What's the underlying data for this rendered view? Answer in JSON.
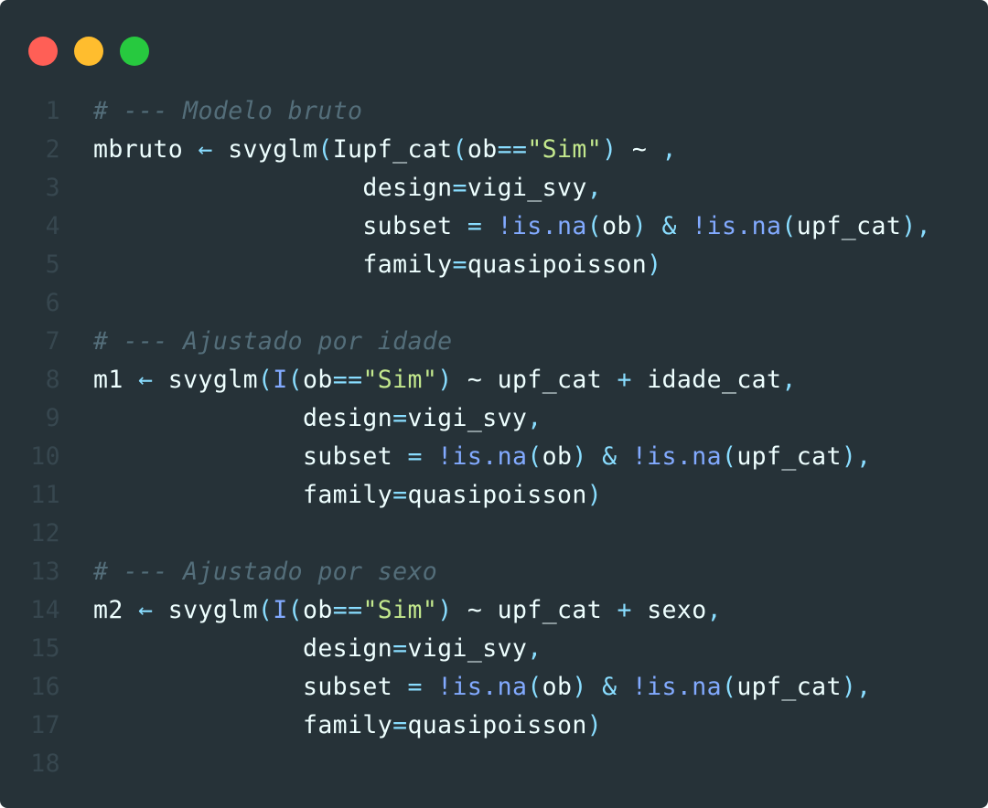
{
  "colors": {
    "background": "#263238",
    "text": "#eeffff",
    "comment": "#546e7a",
    "operator": "#89ddff",
    "string": "#c3e88d",
    "function": "#82aaff",
    "line_number": "#37474f"
  },
  "window_controls": [
    "close-dot",
    "minimize-dot",
    "maximize-dot"
  ],
  "lines": [
    [
      {
        "t": "# --- Modelo bruto",
        "c": "comment"
      }
    ],
    [
      {
        "t": "mbruto "
      },
      {
        "t": "←",
        "c": "op"
      },
      {
        "t": " svyglm"
      },
      {
        "t": "(",
        "c": "op"
      },
      {
        "t": "Iupf_cat"
      },
      {
        "t": "(",
        "c": "op"
      },
      {
        "t": "ob"
      },
      {
        "t": "==",
        "c": "op"
      },
      {
        "t": "\"Sim\"",
        "c": "str"
      },
      {
        "t": ")",
        "c": "op"
      },
      {
        "t": " ~ "
      },
      {
        "t": ",",
        "c": "op"
      }
    ],
    [
      {
        "t": "                  design"
      },
      {
        "t": "=",
        "c": "op"
      },
      {
        "t": "vigi_svy"
      },
      {
        "t": ",",
        "c": "op"
      }
    ],
    [
      {
        "t": "                  subset "
      },
      {
        "t": "=",
        "c": "op"
      },
      {
        "t": " "
      },
      {
        "t": "!is.na",
        "c": "fn"
      },
      {
        "t": "(",
        "c": "op"
      },
      {
        "t": "ob"
      },
      {
        "t": ")",
        "c": "op"
      },
      {
        "t": " "
      },
      {
        "t": "&",
        "c": "op"
      },
      {
        "t": " "
      },
      {
        "t": "!is.na",
        "c": "fn"
      },
      {
        "t": "(",
        "c": "op"
      },
      {
        "t": "upf_cat"
      },
      {
        "t": "),",
        "c": "op"
      }
    ],
    [
      {
        "t": "                  family"
      },
      {
        "t": "=",
        "c": "op"
      },
      {
        "t": "quasipoisson"
      },
      {
        "t": ")",
        "c": "op"
      }
    ],
    [],
    [
      {
        "t": "# --- Ajustado por idade",
        "c": "comment"
      }
    ],
    [
      {
        "t": "m1 "
      },
      {
        "t": "←",
        "c": "op"
      },
      {
        "t": " svyglm"
      },
      {
        "t": "(",
        "c": "op"
      },
      {
        "t": "I",
        "c": "fn"
      },
      {
        "t": "(",
        "c": "op"
      },
      {
        "t": "ob"
      },
      {
        "t": "==",
        "c": "op"
      },
      {
        "t": "\"Sim\"",
        "c": "str"
      },
      {
        "t": ")",
        "c": "op"
      },
      {
        "t": " ~ upf_cat "
      },
      {
        "t": "+",
        "c": "op"
      },
      {
        "t": " idade_cat"
      },
      {
        "t": ",",
        "c": "op"
      }
    ],
    [
      {
        "t": "              design"
      },
      {
        "t": "=",
        "c": "op"
      },
      {
        "t": "vigi_svy"
      },
      {
        "t": ",",
        "c": "op"
      }
    ],
    [
      {
        "t": "              subset "
      },
      {
        "t": "=",
        "c": "op"
      },
      {
        "t": " "
      },
      {
        "t": "!is.na",
        "c": "fn"
      },
      {
        "t": "(",
        "c": "op"
      },
      {
        "t": "ob"
      },
      {
        "t": ")",
        "c": "op"
      },
      {
        "t": " "
      },
      {
        "t": "&",
        "c": "op"
      },
      {
        "t": " "
      },
      {
        "t": "!is.na",
        "c": "fn"
      },
      {
        "t": "(",
        "c": "op"
      },
      {
        "t": "upf_cat"
      },
      {
        "t": "),",
        "c": "op"
      }
    ],
    [
      {
        "t": "              family"
      },
      {
        "t": "=",
        "c": "op"
      },
      {
        "t": "quasipoisson"
      },
      {
        "t": ")",
        "c": "op"
      }
    ],
    [],
    [
      {
        "t": "# --- Ajustado por sexo",
        "c": "comment"
      }
    ],
    [
      {
        "t": "m2 "
      },
      {
        "t": "←",
        "c": "op"
      },
      {
        "t": " svyglm"
      },
      {
        "t": "(",
        "c": "op"
      },
      {
        "t": "I",
        "c": "fn"
      },
      {
        "t": "(",
        "c": "op"
      },
      {
        "t": "ob"
      },
      {
        "t": "==",
        "c": "op"
      },
      {
        "t": "\"Sim\"",
        "c": "str"
      },
      {
        "t": ")",
        "c": "op"
      },
      {
        "t": " ~ upf_cat "
      },
      {
        "t": "+",
        "c": "op"
      },
      {
        "t": " sexo"
      },
      {
        "t": ",",
        "c": "op"
      }
    ],
    [
      {
        "t": "              design"
      },
      {
        "t": "=",
        "c": "op"
      },
      {
        "t": "vigi_svy"
      },
      {
        "t": ",",
        "c": "op"
      }
    ],
    [
      {
        "t": "              subset "
      },
      {
        "t": "=",
        "c": "op"
      },
      {
        "t": " "
      },
      {
        "t": "!is.na",
        "c": "fn"
      },
      {
        "t": "(",
        "c": "op"
      },
      {
        "t": "ob"
      },
      {
        "t": ")",
        "c": "op"
      },
      {
        "t": " "
      },
      {
        "t": "&",
        "c": "op"
      },
      {
        "t": " "
      },
      {
        "t": "!is.na",
        "c": "fn"
      },
      {
        "t": "(",
        "c": "op"
      },
      {
        "t": "upf_cat"
      },
      {
        "t": "),",
        "c": "op"
      }
    ],
    [
      {
        "t": "              family"
      },
      {
        "t": "=",
        "c": "op"
      },
      {
        "t": "quasipoisson"
      },
      {
        "t": ")",
        "c": "op"
      }
    ],
    []
  ]
}
